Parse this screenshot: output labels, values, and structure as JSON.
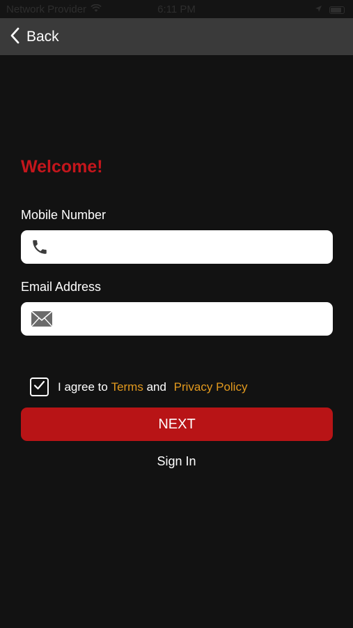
{
  "status_bar": {
    "carrier": "Network Provider",
    "time": "6:11 PM",
    "icons": [
      "wifi-icon",
      "location-arrow-icon",
      "battery-icon"
    ]
  },
  "nav": {
    "back_label": "Back",
    "back_icon": "chevron-left-icon"
  },
  "form": {
    "title": "Welcome!",
    "mobile": {
      "label": "Mobile Number",
      "value": "",
      "placeholder": "",
      "icon": "phone-icon"
    },
    "email": {
      "label": "Email Address",
      "value": "",
      "placeholder": "",
      "icon": "envelope-icon"
    },
    "agree": {
      "checked": true,
      "prefix": "I agree to ",
      "terms_link": "Terms",
      "conjunction": " and ",
      "privacy_link": "Privacy Policy"
    },
    "next_label": "NEXT",
    "sign_in_label": "Sign In"
  },
  "colors": {
    "background": "#121212",
    "nav_bar": "#3a3a3a",
    "accent_red": "#c4161c",
    "button_red": "#b81416",
    "link_orange": "#e39a1e"
  }
}
